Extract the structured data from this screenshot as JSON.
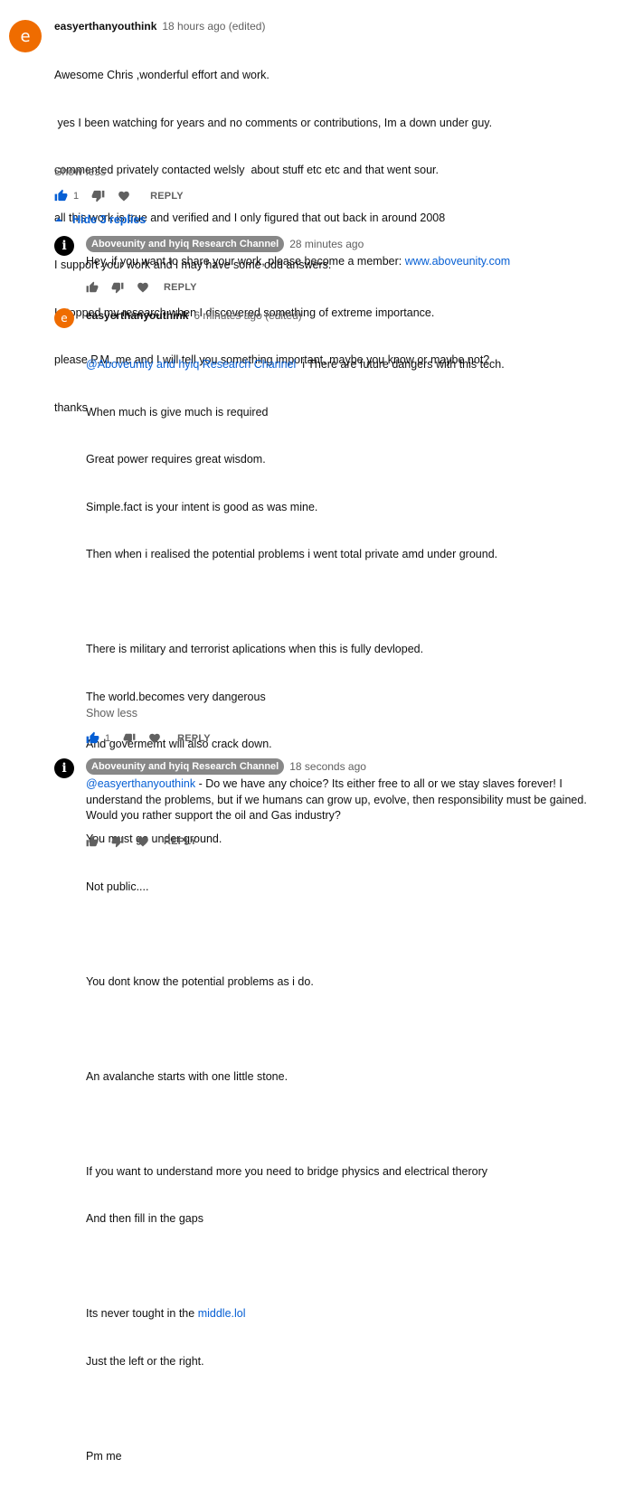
{
  "comment1": {
    "avatar_letter": "e",
    "author": "easyerthanyouthink",
    "time": "18 hours ago (edited)",
    "lines": [
      "Awesome Chris ,wonderful effort and work.",
      " yes I been watching for years and no comments or contributions, Im a down under guy.",
      "commented privately contacted welsly  about stuff etc etc and that went sour.",
      "all this work is true and verified and I only figured that out back in around 2008",
      "I support your work and i may have some odd answers.",
      "I stopped my research when I discovered something of extreme importance.",
      "please P.M. me and I will tell you something important, maybe you know or maybe not?",
      "thanks"
    ],
    "show_less": "Show less",
    "like_count": "1",
    "reply_label": "REPLY",
    "liked": true
  },
  "replies_toggle": {
    "label": "Hide 3 replies"
  },
  "reply1": {
    "avatar_letter": "i",
    "author": "Aboveunity and hyiq Research Channel",
    "time": "28 minutes ago",
    "text": "Hey, if you want to share your work, please become a member: ",
    "link": "www.aboveunity.com",
    "reply_label": "REPLY"
  },
  "reply2": {
    "avatar_letter": "e",
    "author": "easyerthanyouthink",
    "time": "6 minutes ago (edited)",
    "mention": "@Aboveunity and hyiq Research Channel",
    "first_line_rest": "  i There are future dangers with this tech.",
    "lines": [
      "When much is give much is required",
      "Great power requires great wisdom.",
      "Simple.fact is your intent is good as was mine.",
      "Then when i realised the potential problems i went total private amd under ground.",
      "",
      "There is military and terrorist aplications when this is fully devloped.",
      "The world.becomes very dangerous",
      "And govermemt will also crack down.",
      "",
      "You must go under ground.",
      "Not public....",
      "",
      "You dont know the potential problems as i do.",
      "",
      "An avalanche starts with one little stone.",
      "",
      "If you want to understand more you need to bridge physics and electrical therory",
      "And then fill in the gaps",
      ""
    ],
    "middle_prefix": "Its never tought in the ",
    "middle_link": "middle.lol",
    "after_lines": [
      "Just the left or the right.",
      "",
      "Pm me"
    ],
    "show_less": "Show less",
    "like_count": "1",
    "reply_label": "REPLY"
  },
  "reply3": {
    "avatar_letter": "i",
    "author": "Aboveunity and hyiq Research Channel",
    "time": "18 seconds ago",
    "mention": "@easyerthanyouthink",
    "text": " - Do we have any choice? Its either free to all or we stay slaves forever! I understand the problems, but if we humans can grow up, evolve, then responsibility must be gained. Would you rather support the oil and Gas industry?",
    "reply_label": "REPLY"
  },
  "colors": {
    "link": "#065fd4",
    "avatar_orange": "#ef6c00",
    "owner_badge": "#888888",
    "like_active": "#065fd4",
    "icon_gray": "#606060"
  }
}
